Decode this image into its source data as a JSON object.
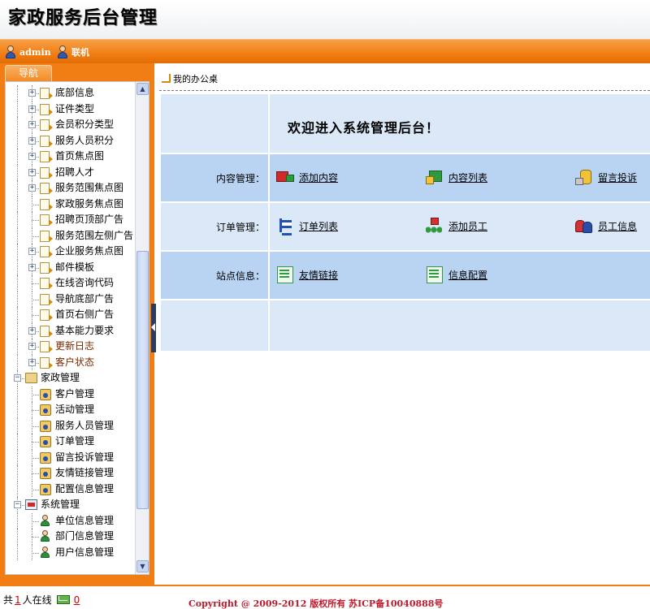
{
  "header": {
    "title": "家政服务后台管理"
  },
  "userbar": {
    "user": "admin",
    "status": "联机"
  },
  "nav": {
    "tab_label": "导航",
    "tree": [
      {
        "label": "底部信息",
        "level": 1,
        "icon": "page",
        "expander": "+",
        "highlight": false
      },
      {
        "label": "证件类型",
        "level": 1,
        "icon": "page",
        "expander": "+",
        "highlight": false
      },
      {
        "label": "会员积分类型",
        "level": 1,
        "icon": "page",
        "expander": "+",
        "highlight": false
      },
      {
        "label": "服务人员积分",
        "level": 1,
        "icon": "page",
        "expander": "+",
        "highlight": false
      },
      {
        "label": "首页焦点图",
        "level": 1,
        "icon": "page",
        "expander": "+",
        "highlight": false
      },
      {
        "label": "招聘人才",
        "level": 1,
        "icon": "page",
        "expander": "+",
        "highlight": false
      },
      {
        "label": "服务范围焦点图",
        "level": 1,
        "icon": "page",
        "expander": "+",
        "highlight": false
      },
      {
        "label": "家政服务焦点图",
        "level": 1,
        "icon": "page",
        "expander": "",
        "highlight": false
      },
      {
        "label": "招聘页顶部广告",
        "level": 1,
        "icon": "page",
        "expander": "",
        "highlight": false
      },
      {
        "label": "服务范围左侧广告",
        "level": 1,
        "icon": "page",
        "expander": "",
        "highlight": false
      },
      {
        "label": "企业服务焦点图",
        "level": 1,
        "icon": "page",
        "expander": "+",
        "highlight": false
      },
      {
        "label": "邮件模板",
        "level": 1,
        "icon": "page",
        "expander": "+",
        "highlight": false
      },
      {
        "label": "在线咨询代码",
        "level": 1,
        "icon": "page",
        "expander": "",
        "highlight": false
      },
      {
        "label": "导航底部广告",
        "level": 1,
        "icon": "page",
        "expander": "",
        "highlight": false
      },
      {
        "label": "首页右侧广告",
        "level": 1,
        "icon": "page",
        "expander": "",
        "highlight": false
      },
      {
        "label": "基本能力要求",
        "level": 1,
        "icon": "page",
        "expander": "+",
        "highlight": false
      },
      {
        "label": "更新日志",
        "level": 1,
        "icon": "page",
        "expander": "+",
        "highlight": true
      },
      {
        "label": "客户状态",
        "level": 1,
        "icon": "page",
        "expander": "+",
        "highlight": true
      },
      {
        "label": "家政管理",
        "level": 0,
        "icon": "folder",
        "expander": "-",
        "highlight": false
      },
      {
        "label": "客户管理",
        "level": 1,
        "icon": "person",
        "expander": "",
        "highlight": false
      },
      {
        "label": "活动管理",
        "level": 1,
        "icon": "person",
        "expander": "",
        "highlight": false
      },
      {
        "label": "服务人员管理",
        "level": 1,
        "icon": "person",
        "expander": "",
        "highlight": false
      },
      {
        "label": "订单管理",
        "level": 1,
        "icon": "person",
        "expander": "",
        "highlight": false
      },
      {
        "label": "留言投诉管理",
        "level": 1,
        "icon": "person",
        "expander": "",
        "highlight": false
      },
      {
        "label": "友情链接管理",
        "level": 1,
        "icon": "person",
        "expander": "",
        "highlight": false
      },
      {
        "label": "配置信息管理",
        "level": 1,
        "icon": "person",
        "expander": "",
        "highlight": false
      },
      {
        "label": "系统管理",
        "level": 0,
        "icon": "system",
        "expander": "-",
        "highlight": false
      },
      {
        "label": "单位信息管理",
        "level": 1,
        "icon": "user",
        "expander": "",
        "highlight": false
      },
      {
        "label": "部门信息管理",
        "level": 1,
        "icon": "user",
        "expander": "",
        "highlight": false
      },
      {
        "label": "用户信息管理",
        "level": 1,
        "icon": "user",
        "expander": "",
        "highlight": false
      }
    ]
  },
  "main": {
    "breadcrumb": "我的办公桌",
    "welcome": "欢迎进入系统管理后台！",
    "sections": [
      {
        "label": "内容管理：",
        "links": [
          {
            "text": "添加内容",
            "icon": "truck-icon"
          },
          {
            "text": "内容列表",
            "icon": "truck2-icon"
          },
          {
            "text": "留言投诉",
            "icon": "database-icon"
          }
        ]
      },
      {
        "label": "订单管理：",
        "links": [
          {
            "text": "订单列表",
            "icon": "orgtree-icon"
          },
          {
            "text": "添加员工",
            "icon": "diamond-icon"
          },
          {
            "text": "员工信息",
            "icon": "staff-icon"
          }
        ]
      },
      {
        "label": "站点信息：",
        "links": [
          {
            "text": "友情链接",
            "icon": "list-icon"
          },
          {
            "text": "信息配置",
            "icon": "list-icon"
          }
        ]
      }
    ]
  },
  "footer": {
    "online_prefix": "共",
    "online_count": "1",
    "online_suffix": "人在线",
    "message_count": "0",
    "copyright": "Copyright @ 2009-2012 版权所有  苏ICP备10040888号"
  },
  "colors": {
    "accent": "#f07e14",
    "panel_light": "#dbe8f8",
    "panel_dark": "#b9d3f3",
    "copyright": "#c0182a"
  }
}
